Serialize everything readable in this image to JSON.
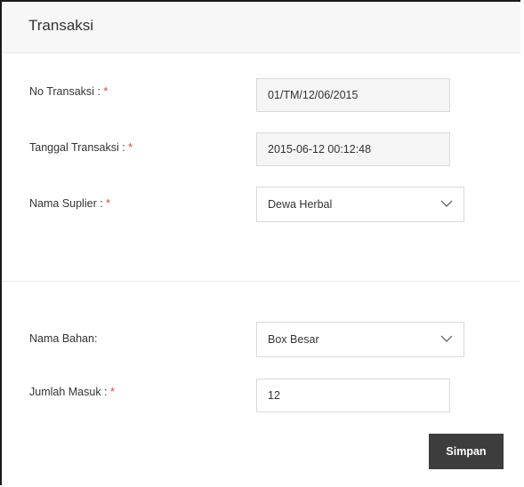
{
  "panel": {
    "title": "Transaksi"
  },
  "form": {
    "no_transaksi": {
      "label": "No Transaksi : ",
      "required_mark": "*",
      "value": "01/TM/12/06/2015"
    },
    "tanggal_transaksi": {
      "label": "Tanggal Transaksi : ",
      "required_mark": "*",
      "value": "2015-06-12 00:12:48"
    },
    "nama_suplier": {
      "label": "Nama Suplier :  ",
      "required_mark": "*",
      "selected": "Dewa Herbal"
    },
    "nama_bahan": {
      "label": "Nama Bahan:",
      "selected": "Box Besar"
    },
    "jumlah_masuk": {
      "label": "Jumlah Masuk : ",
      "required_mark": "*",
      "value": "12"
    },
    "submit_label": "Simpan"
  },
  "icons": {
    "dropdown": "chevron-down-icon"
  },
  "colors": {
    "required": "#e0423a",
    "button_bg": "#3d3d3d",
    "header_bg": "#f7f7f7"
  }
}
